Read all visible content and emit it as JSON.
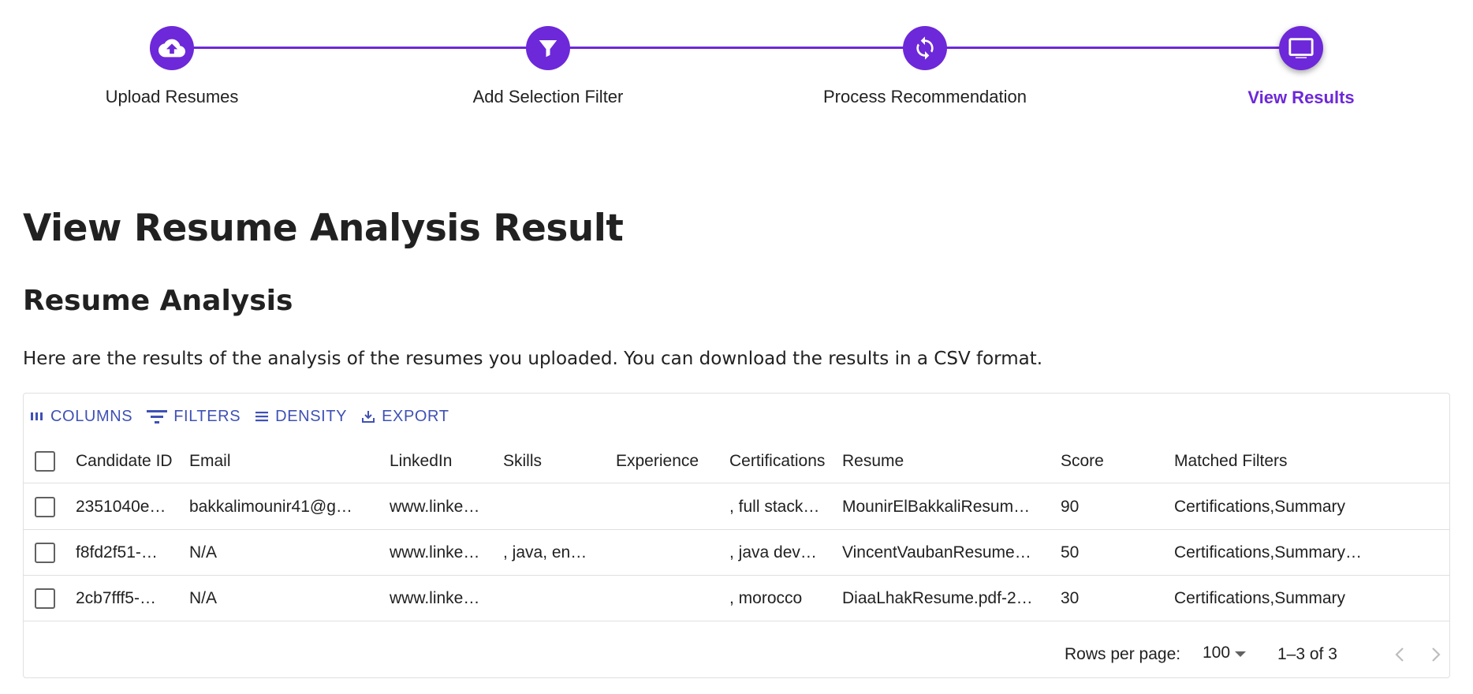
{
  "stepper": {
    "steps": [
      {
        "label": "Upload Resumes",
        "icon": "cloud-upload-icon"
      },
      {
        "label": "Add Selection Filter",
        "icon": "filter-icon"
      },
      {
        "label": "Process Recommendation",
        "icon": "refresh-icon"
      },
      {
        "label": "View Results",
        "icon": "monitor-icon",
        "active": true
      }
    ],
    "accent_color": "#6d28d9"
  },
  "page_title": "View Resume Analysis Result",
  "section_title": "Resume Analysis",
  "description": "Here are the results of the analysis of the resumes you uploaded. You can download the results in a CSV format.",
  "toolbar": {
    "columns_label": "COLUMNS",
    "filters_label": "FILTERS",
    "density_label": "DENSITY",
    "export_label": "EXPORT",
    "color": "#3f51b5"
  },
  "table": {
    "columns": [
      "Candidate ID",
      "Email",
      "LinkedIn",
      "Skills",
      "Experience",
      "Certifications",
      "Resume",
      "Score",
      "Matched Filters"
    ],
    "rows": [
      [
        "2351040e…",
        "bakkalimounir41@g…",
        "www.linke…",
        "",
        "",
        ", full stack…",
        "MounirElBakkaliResum…",
        "90",
        "Certifications,Summary"
      ],
      [
        "f8fd2f51-…",
        "N/A",
        "www.linke…",
        ", java, en…",
        "",
        ", java dev…",
        "VincentVaubanResume…",
        "50",
        "Certifications,Summary…"
      ],
      [
        "2cb7fff5-…",
        "N/A",
        "www.linke…",
        "",
        "",
        ", morocco",
        "DiaaLhakResume.pdf-2…",
        "30",
        "Certifications,Summary"
      ]
    ]
  },
  "footer": {
    "rows_per_page_label": "Rows per page:",
    "rows_per_page_value": "100",
    "range": "1–3 of 3"
  }
}
